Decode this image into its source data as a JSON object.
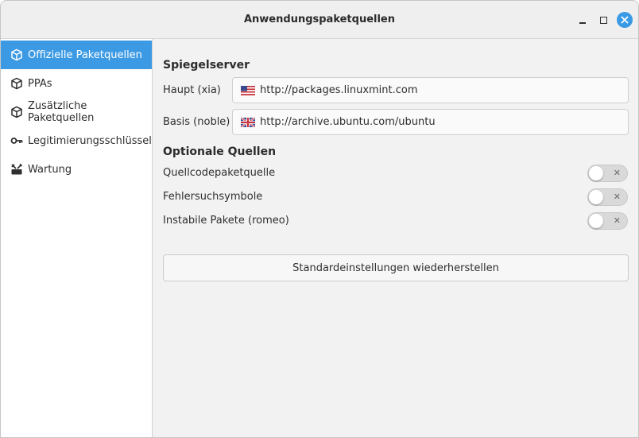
{
  "window": {
    "title": "Anwendungspaketquellen"
  },
  "sidebar": {
    "items": [
      {
        "label": "Offizielle Paketquellen",
        "icon": "package-icon"
      },
      {
        "label": "PPAs",
        "icon": "package-icon"
      },
      {
        "label": "Zusätzliche Paketquellen",
        "icon": "package-icon"
      },
      {
        "label": "Legitimierungsschlüssel",
        "icon": "key-icon"
      },
      {
        "label": "Wartung",
        "icon": "tools-icon"
      }
    ],
    "active_index": 0
  },
  "mirrors": {
    "heading": "Spiegelserver",
    "main": {
      "label": "Haupt (xia)",
      "value": "http://packages.linuxmint.com",
      "flag": "us-flag-icon"
    },
    "base": {
      "label": "Basis (noble)",
      "value": "http://archive.ubuntu.com/ubuntu",
      "flag": "uk-flag-icon"
    }
  },
  "optional": {
    "heading": "Optionale Quellen",
    "items": [
      {
        "label": "Quellcodepaketquelle",
        "enabled": false
      },
      {
        "label": "Fehlersuchsymbole",
        "enabled": false
      },
      {
        "label": "Instabile Pakete (romeo)",
        "enabled": false
      }
    ],
    "toggle_off_glyph": "✕"
  },
  "reset_button": {
    "label": "Standardeinstellungen wiederherstellen"
  },
  "colors": {
    "accent": "#3c9ae4",
    "close": "#3a9ae6"
  }
}
